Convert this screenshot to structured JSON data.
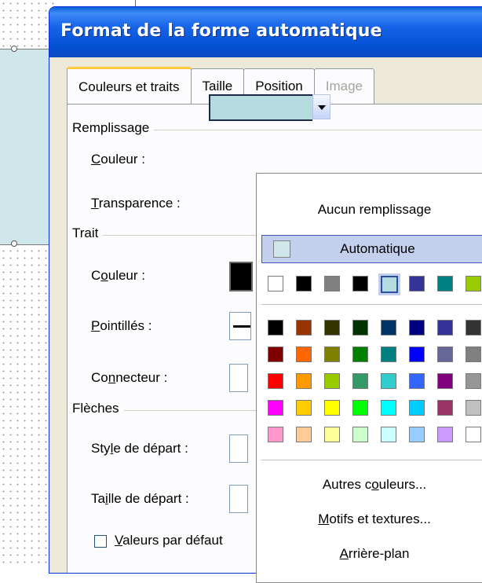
{
  "dialog": {
    "title": "Format de la forme automatique"
  },
  "tabs": [
    {
      "label": "Couleurs et traits",
      "state": "active"
    },
    {
      "label": "Taille",
      "state": "normal"
    },
    {
      "label": "Position",
      "state": "normal"
    },
    {
      "label": "Image",
      "state": "disabled"
    }
  ],
  "remplissage": {
    "group_label": "Remplissage",
    "couleur_label_u": "C",
    "couleur_label_rest": "ouleur :",
    "transparence_label_u": "T",
    "transparence_label_rest": "ransparence :",
    "selected_color": "#b5dbe1"
  },
  "trait": {
    "group_label": "Trait",
    "couleur_pre": "C",
    "couleur_u": "o",
    "couleur_rest": "uleur :",
    "pointilles_u": "P",
    "pointilles_rest": "ointillés :",
    "connecteur_pre": "Co",
    "connecteur_u": "n",
    "connecteur_rest": "necteur :"
  },
  "fleches": {
    "group_label": "Flèches",
    "style_pre": "Sty",
    "style_u": "l",
    "style_rest": "e de départ :",
    "taille_pre": "Ta",
    "taille_u": "i",
    "taille_rest": "lle de départ :",
    "defaut_u": "V",
    "defaut_rest": "aleurs par défaut"
  },
  "dropdown": {
    "aucun": "Aucun remplissage",
    "automatique": "Automatique",
    "autres_pre": "Autres c",
    "autres_u": "o",
    "autres_rest": "uleurs...",
    "motifs_u": "M",
    "motifs_rest": "otifs et textures...",
    "arriere_u": "A",
    "arriere_rest": "rrière-plan",
    "recent_colors": [
      "#ffffff",
      "#000000",
      "#808080",
      "#000000",
      "#b5dbe1",
      "#333399",
      "#008080",
      "#99cc00"
    ],
    "palette": [
      [
        "#000000",
        "#993300",
        "#333300",
        "#003300",
        "#003366",
        "#000080",
        "#333399",
        "#333333"
      ],
      [
        "#800000",
        "#ff6600",
        "#808000",
        "#008000",
        "#008080",
        "#0000ff",
        "#666699",
        "#808080"
      ],
      [
        "#ff0000",
        "#ff9900",
        "#99cc00",
        "#339966",
        "#33cccc",
        "#3366ff",
        "#800080",
        "#969696"
      ],
      [
        "#ff00ff",
        "#ffcc00",
        "#ffff00",
        "#00ff00",
        "#00ffff",
        "#00ccff",
        "#993366",
        "#c0c0c0"
      ],
      [
        "#ff99cc",
        "#ffcc99",
        "#ffff99",
        "#ccffcc",
        "#ccffff",
        "#99ccff",
        "#cc99ff",
        "#ffffff"
      ]
    ]
  }
}
